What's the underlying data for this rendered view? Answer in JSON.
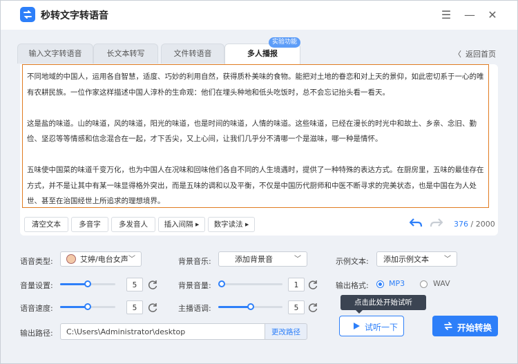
{
  "app": {
    "title": "秒转文字转语音",
    "minimize": "—",
    "close": "✕",
    "menu": "☰"
  },
  "tabs": [
    {
      "label": "输入文字转语音"
    },
    {
      "label": "长文本转写"
    },
    {
      "label": "文件转语音"
    },
    {
      "label": "多人播报",
      "active": true
    }
  ],
  "badge": "实验功能",
  "back_link": "返回首页",
  "editor": {
    "paragraphs": [
      "不同地域的中国人，运用各自智慧，适度、巧妙的利用自然，获得质朴美味的食物。能把对土地的眷恋和对上天的景仰，如此密切系于一心的唯有农耕民族。一位作家这样描述中国人淳朴的生命观：他们在埋头种地和低头吃饭时，总不会忘记抬头看一看天。",
      "这是盐的味道。山的味道，风的味道，阳光的味道，也是时间的味道，人情的味道。这些味道，已经在漫长的时光中和故土、乡亲、念旧、勤俭、坚忍等等情感和信念混合在一起，才下舌尖，又上心间，让我们几乎分不清哪一个是滋味，哪一种是情怀。",
      "五味使中国菜的味道千变万化，也为中国人在况味和回味他们各自不同的人生境遇时，提供了一种特殊的表达方式。在厨房里，五味的最佳存在方式，并不是让其中有某一味显得格外突出，而是五味的调和以及平衡，不仅是中国历代厨师和中医不断寻求的完美状态，也是中国在为人处世、甚至在治国经世上所追求的理想境界。"
    ],
    "tools": [
      "清空文本",
      "多音字",
      "多发音人",
      "插入间隔 ▸",
      "数字读法 ▸"
    ],
    "count_current": "376",
    "count_sep": " / ",
    "count_max": "2000"
  },
  "settings": {
    "voice_type_label": "语音类型:",
    "voice_type_value": "艾婷/电台女声",
    "bg_music_label": "背景音乐:",
    "bg_music_value": "添加背景音",
    "sample_text_label": "示例文本:",
    "sample_text_value": "添加示例文本",
    "volume_label": "音量设置:",
    "volume_value": "5",
    "bg_volume_label": "背景音量:",
    "bg_volume_value": "1",
    "speed_label": "语音速度:",
    "speed_value": "5",
    "tone_label": "主播语调:",
    "tone_value": "5",
    "format_label": "输出格式:",
    "format_mp3": "MP3",
    "format_wav": "WAV",
    "path_label": "输出路径:",
    "path_value": "C:\\Users\\Administrator\\desktop",
    "path_button": "更改路径"
  },
  "levels": {
    "volume": 0.5,
    "bg_volume": 0.0,
    "speed": 0.5,
    "tone": 0.5
  },
  "tooltip": "点击此处开始试听",
  "preview_button": "试听一下",
  "convert_button": "开始转换",
  "colors": {
    "accent": "#2d7ff9",
    "editor_border": "#e07b20"
  }
}
